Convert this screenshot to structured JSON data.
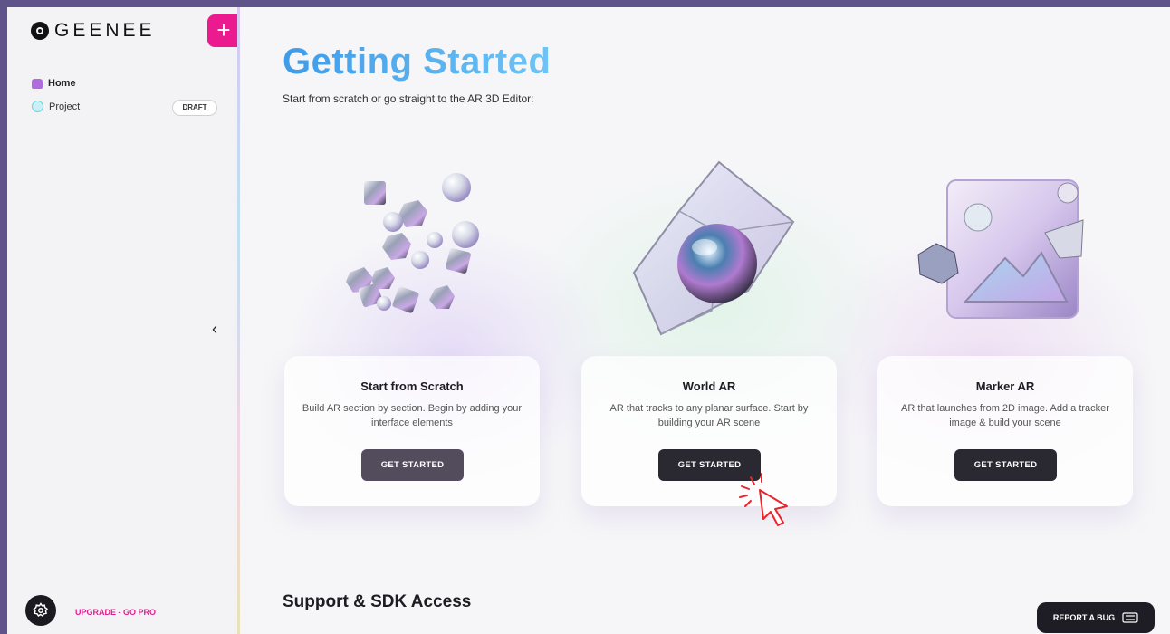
{
  "sidebar": {
    "logo_text": "GEENEE",
    "add_label": "+",
    "nav": [
      {
        "label": "Home",
        "icon": "home-icon"
      },
      {
        "label": "Project",
        "icon": "circle-icon",
        "badge": "DRAFT"
      }
    ],
    "collapse_label": "‹",
    "upgrade_label": "UPGRADE - GO PRO"
  },
  "main": {
    "title": "Getting Started",
    "subtitle": "Start from scratch or go straight to the AR 3D Editor:",
    "cards": [
      {
        "title": "Start from Scratch",
        "description": "Build AR section by section. Begin by adding your interface elements",
        "button": "GET STARTED"
      },
      {
        "title": "World AR",
        "description": "AR that tracks to any planar surface. Start by building your AR scene",
        "button": "GET STARTED"
      },
      {
        "title": "Marker AR",
        "description": "AR that launches from 2D image. Add a tracker image & build your scene",
        "button": "GET STARTED"
      }
    ],
    "support_heading": "Support & SDK Access",
    "report_bug_label": "REPORT A BUG"
  },
  "colors": {
    "accent_pink": "#ec1a8f",
    "title_blue": "#4aa6ee",
    "button_dark": "#2a2830",
    "frame_purple": "#5f5489"
  }
}
